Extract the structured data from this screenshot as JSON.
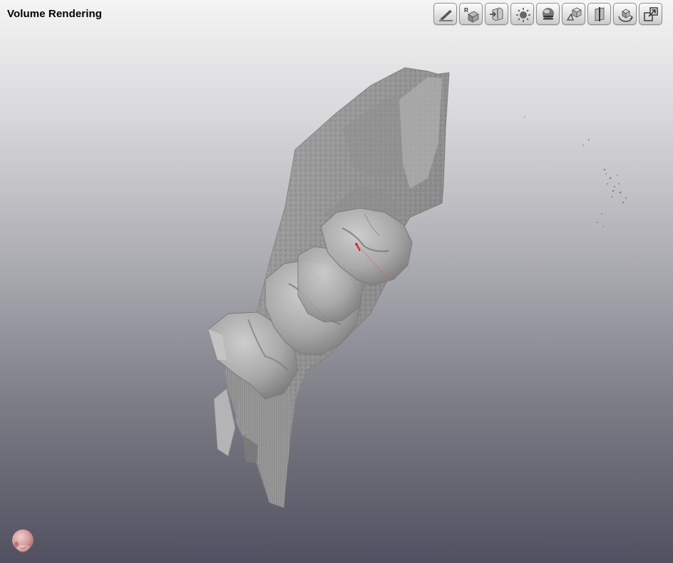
{
  "view": {
    "title": "Volume Rendering"
  },
  "toolbar": {
    "buttons": [
      {
        "name": "scalpel-tool-button",
        "icon": "scalpel-icon"
      },
      {
        "name": "reset-orientation-button",
        "icon": "axis-cube-icon",
        "label": "R"
      },
      {
        "name": "clipping-plane-button",
        "icon": "clipping-box-icon"
      },
      {
        "name": "lighting-button",
        "icon": "light-icon"
      },
      {
        "name": "render-mode-button",
        "icon": "sphere-shading-icon"
      },
      {
        "name": "view-3d-button",
        "icon": "cube-view-icon"
      },
      {
        "name": "slice-plane-button",
        "icon": "plane-icon"
      },
      {
        "name": "rotate-view-button",
        "icon": "rotate-cube-icon"
      },
      {
        "name": "maximize-view-button",
        "icon": "maximize-icon"
      }
    ]
  },
  "colors": {
    "bone": "#a7a7a7",
    "tooth": "#b3b3b3",
    "marker": "#d81b1b",
    "background_top": "#f4f4f4",
    "background_bottom": "#505060",
    "orientation_head": "#d49a98"
  },
  "orientation_widget": {
    "icon": "head-orientation-icon"
  }
}
